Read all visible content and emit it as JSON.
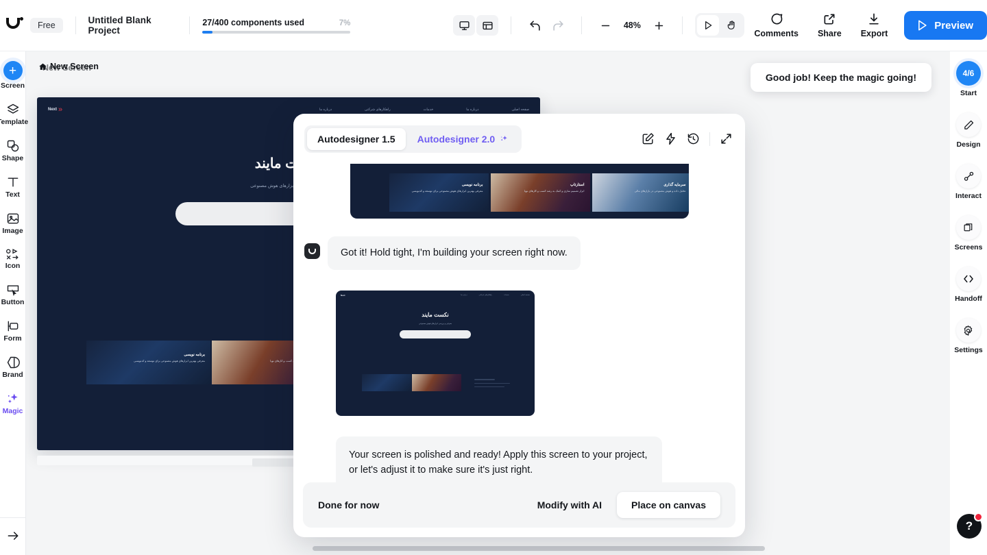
{
  "topbar": {
    "logo_name": "uizard-logo",
    "plan_badge": "Free",
    "project_title": "Untitled Blank Project",
    "usage_text": "27/400 components used",
    "usage_percent_label": "7%",
    "usage_percent_value": 7,
    "zoom_level": "48%",
    "icons": {
      "desktop_preview": "desktop-icon",
      "multi_screen": "screens-grid-icon",
      "undo": "undo-icon",
      "redo": "redo-icon",
      "zoom_out": "minus-icon",
      "zoom_in": "plus-icon",
      "play_tool": "play-cursor-icon",
      "hand_tool": "hand-icon"
    },
    "comments_label": "Comments",
    "share_label": "Share",
    "export_label": "Export",
    "preview_label": "Preview",
    "accent_color": "#1878f2"
  },
  "left_rail": {
    "items": [
      {
        "label": "Screen",
        "icon": "plus-icon"
      },
      {
        "label": "Template",
        "icon": "layers-icon"
      },
      {
        "label": "Shape",
        "icon": "shapes-icon"
      },
      {
        "label": "Text",
        "icon": "text-icon"
      },
      {
        "label": "Image",
        "icon": "image-icon"
      },
      {
        "label": "Icon",
        "icon": "icon-set-icon"
      },
      {
        "label": "Button",
        "icon": "button-cursor-icon"
      },
      {
        "label": "Form",
        "icon": "form-icon"
      },
      {
        "label": "Brand",
        "icon": "brand-icon"
      },
      {
        "label": "Magic",
        "icon": "sparkle-icon"
      }
    ],
    "collapse_icon": "arrow-right-icon",
    "magic_color": "#6b4df0"
  },
  "right_rail": {
    "items": [
      {
        "label": "Start",
        "icon": "step-counter",
        "badge": "4/6"
      },
      {
        "label": "Design",
        "icon": "pencil-icon"
      },
      {
        "label": "Interact",
        "icon": "nodes-icon"
      },
      {
        "label": "Screens",
        "icon": "copy-stack-icon"
      },
      {
        "label": "Handoff",
        "icon": "code-icon"
      },
      {
        "label": "Settings",
        "icon": "gear-icon"
      }
    ]
  },
  "canvas": {
    "screen_label": "New Screen",
    "home_icon": "home-icon",
    "board": {
      "logo_text": "Next",
      "nav_links": [
        "صفحه اصلی",
        "درباره ما",
        "خدمات",
        "راهکارهای شرکتی",
        "تماس با ما"
      ],
      "hero_title": "نکست مایند",
      "hero_sub": "معرفی و بررسی ابزارهای هوش مصنوعی",
      "cards": [
        {
          "title": "برنامه نویسی",
          "desc": "معرفی بهترین ابزارهای هوش مصنوعی برای توسعه و کدنویسی"
        },
        {
          "title": "استارتاپ",
          "desc": "ابزار تصمیم سازی و کمک به رشد کسب و کارهای نوپا"
        },
        {
          "title": "سرمایه گذاری",
          "desc": "تحلیل داده و هوش مصنوعی در بازارهای مالی"
        }
      ]
    }
  },
  "toast": {
    "message": "Good job! Keep the magic going!"
  },
  "modal": {
    "tabs": [
      {
        "label": "Autodesigner 1.5",
        "active": true,
        "icon": ""
      },
      {
        "label": "Autodesigner 2.0",
        "active": false,
        "icon": "sparkle-icon"
      }
    ],
    "header_icons": [
      "edit-square-icon",
      "lightning-bolt-icon",
      "history-clock-icon",
      "expand-arrows-icon"
    ],
    "messages": [
      {
        "type": "image",
        "name": "generated-cards-preview"
      },
      {
        "type": "bot",
        "text": "Got it! Hold tight, I'm building your screen right now."
      },
      {
        "type": "thumb",
        "name": "generated-screen-thumbnail"
      },
      {
        "type": "bot",
        "text": "Your screen is polished and ready! Apply this screen to your project, or let's adjust it to make sure it's just right."
      }
    ],
    "footer": {
      "done_label": "Done for now",
      "modify_label": "Modify with AI",
      "place_label": "Place on canvas"
    }
  },
  "help": {
    "label": "?",
    "has_notification": true,
    "notification_color": "#f0243c"
  }
}
